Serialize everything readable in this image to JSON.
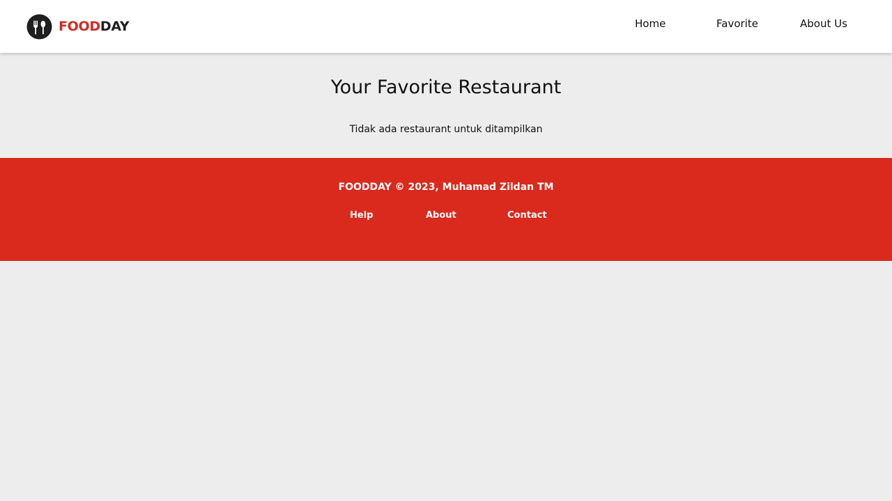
{
  "header": {
    "brand_part1": "FOOD",
    "brand_part2": "DAY",
    "logo_icon": "fork-spoon-plate-icon",
    "nav": {
      "home": "Home",
      "favorite": "Favorite",
      "about": "About Us"
    }
  },
  "main": {
    "title": "Your Favorite Restaurant",
    "empty_message": "Tidak ada restaurant untuk ditampilkan"
  },
  "footer": {
    "copyright": "FOODDAY © 2023, Muhamad Zildan TM",
    "links": {
      "help": "Help",
      "about": "About",
      "contact": "Contact"
    }
  },
  "colors": {
    "brand_red": "#da291d",
    "background": "#ededed",
    "header_bg": "#ffffff",
    "text_dark": "#111111"
  }
}
